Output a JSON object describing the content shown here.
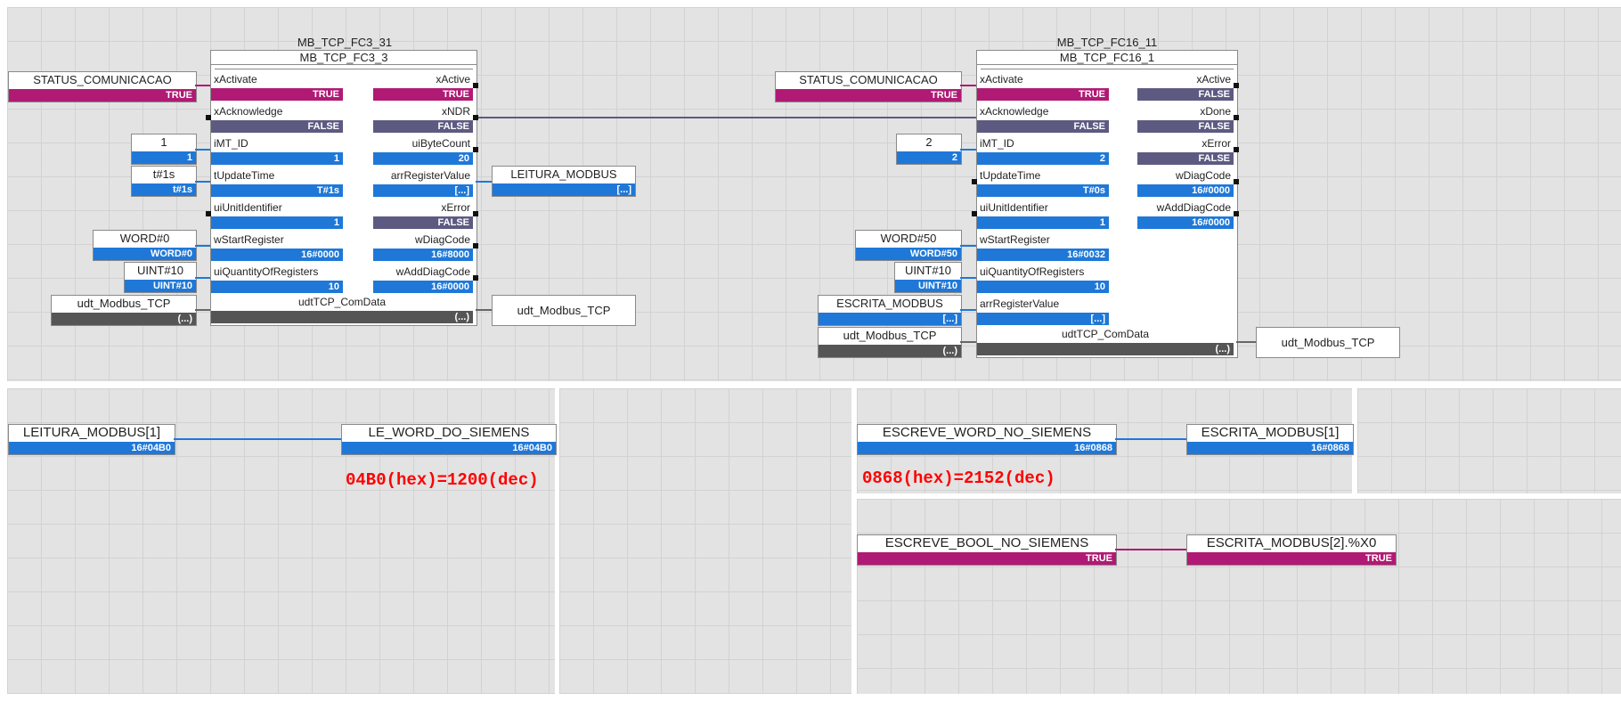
{
  "block1": {
    "instance": "MB_TCP_FC3_31",
    "type": "MB_TCP_FC3_3",
    "inputs": [
      {
        "label": "xActivate",
        "value": "TRUE"
      },
      {
        "label": "xAcknowledge",
        "value": "FALSE"
      },
      {
        "label": "iMT_ID",
        "value": "1"
      },
      {
        "label": "tUpdateTime",
        "value": "T#1s"
      },
      {
        "label": "uiUnitIdentifier",
        "value": "1"
      },
      {
        "label": "wStartRegister",
        "value": "16#0000"
      },
      {
        "label": "uiQuantityOfRegisters",
        "value": "10"
      }
    ],
    "outputs": [
      {
        "label": "xActive",
        "value": "TRUE"
      },
      {
        "label": "xNDR",
        "value": "FALSE"
      },
      {
        "label": "uiByteCount",
        "value": "20"
      },
      {
        "label": "arrRegisterValue",
        "value": "[...]"
      },
      {
        "label": "xError",
        "value": "FALSE"
      },
      {
        "label": "wDiagCode",
        "value": "16#8000"
      },
      {
        "label": "wAddDiagCode",
        "value": "16#0000"
      }
    ],
    "inout": {
      "label": "udtTCP_ComData",
      "value": "(...)"
    }
  },
  "block1_vars": {
    "status": {
      "label": "STATUS_COMUNICACAO",
      "value": "TRUE"
    },
    "mt_id": {
      "label": "1",
      "value": "1"
    },
    "update": {
      "label": "t#1s",
      "value": "t#1s"
    },
    "start": {
      "label": "WORD#0",
      "value": "WORD#0"
    },
    "qty": {
      "label": "UINT#10",
      "value": "UINT#10"
    },
    "udt_in": {
      "label": "udt_Modbus_TCP",
      "value": "(...)"
    },
    "leitura": {
      "label": "LEITURA_MODBUS",
      "value": "[...]"
    },
    "udt_out": {
      "label": "udt_Modbus_TCP"
    }
  },
  "block2": {
    "instance": "MB_TCP_FC16_11",
    "type": "MB_TCP_FC16_1",
    "inputs": [
      {
        "label": "xActivate",
        "value": "TRUE"
      },
      {
        "label": "xAcknowledge",
        "value": "FALSE"
      },
      {
        "label": "iMT_ID",
        "value": "2"
      },
      {
        "label": "tUpdateTime",
        "value": "T#0s"
      },
      {
        "label": "uiUnitIdentifier",
        "value": "1"
      },
      {
        "label": "wStartRegister",
        "value": "16#0032"
      },
      {
        "label": "uiQuantityOfRegisters",
        "value": "10"
      },
      {
        "label": "arrRegisterValue",
        "value": "[...]"
      }
    ],
    "outputs": [
      {
        "label": "xActive",
        "value": "FALSE"
      },
      {
        "label": "xDone",
        "value": "FALSE"
      },
      {
        "label": "xError",
        "value": "FALSE"
      },
      {
        "label": "wDiagCode",
        "value": "16#0000"
      },
      {
        "label": "wAddDiagCode",
        "value": "16#0000"
      }
    ],
    "inout": {
      "label": "udtTCP_ComData",
      "value": "(...)"
    }
  },
  "block2_vars": {
    "status": {
      "label": "STATUS_COMUNICACAO",
      "value": "TRUE"
    },
    "mt_id": {
      "label": "2",
      "value": "2"
    },
    "start": {
      "label": "WORD#50",
      "value": "WORD#50"
    },
    "qty": {
      "label": "UINT#10",
      "value": "UINT#10"
    },
    "escrita": {
      "label": "ESCRITA_MODBUS",
      "value": "[...]"
    },
    "udt_in": {
      "label": "udt_Modbus_TCP",
      "value": "(...)"
    },
    "udt_out": {
      "label": "udt_Modbus_TCP"
    }
  },
  "rung_read": {
    "source": {
      "label": "LEITURA_MODBUS[1]",
      "value": "16#04B0"
    },
    "target": {
      "label": "LE_WORD_DO_SIEMENS",
      "value": "16#04B0"
    },
    "annotation": "04B0(hex)=1200(dec)"
  },
  "rung_write_word": {
    "source": {
      "label": "ESCREVE_WORD_NO_SIEMENS",
      "value": "16#0868"
    },
    "target": {
      "label": "ESCRITA_MODBUS[1]",
      "value": "16#0868"
    },
    "annotation": "0868(hex)=2152(dec)"
  },
  "rung_write_bool": {
    "source": {
      "label": "ESCREVE_BOOL_NO_SIEMENS",
      "value": "TRUE"
    },
    "target": {
      "label": "ESCRITA_MODBUS[2].%X0",
      "value": "TRUE"
    }
  },
  "colors": {
    "true": "#b01a74",
    "value": "#1f78d8",
    "false": "#5d5a82",
    "struct": "#555555",
    "annotation": "#ff0000",
    "grid": "#e3e3e3"
  }
}
